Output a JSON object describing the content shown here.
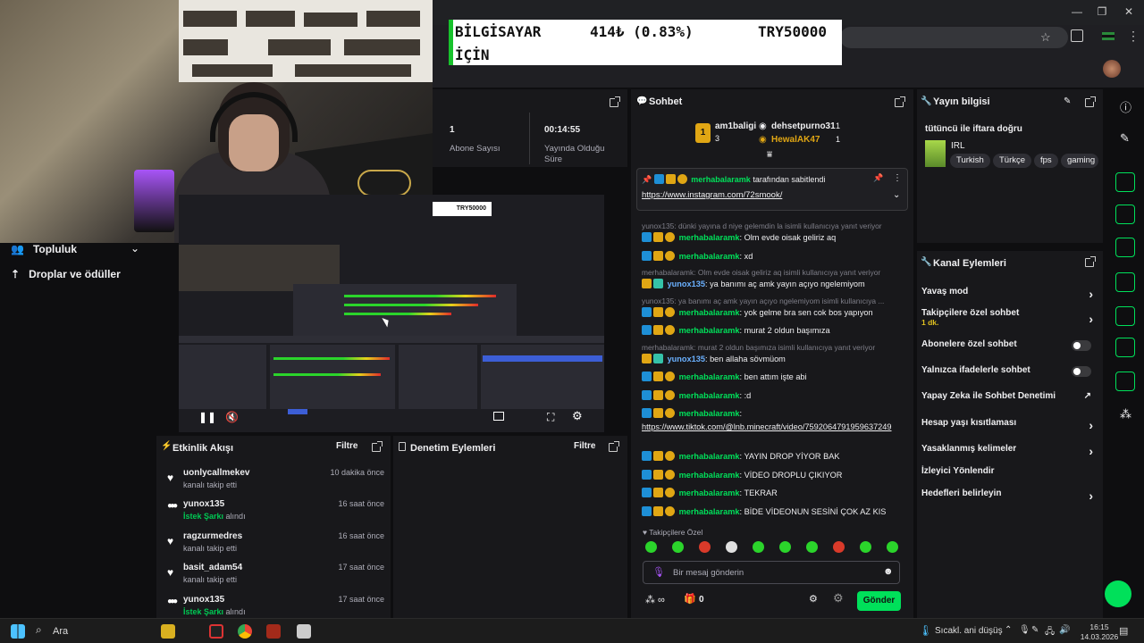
{
  "stock_banner": {
    "symbol_line1": "BİLGİSAYAR",
    "symbol_line2": "İÇİN",
    "change": "414₺ (0.83%)",
    "goal": "TRY50000"
  },
  "sidebar": {
    "items": [
      {
        "label": "Topluluk",
        "icon": "people-icon"
      },
      {
        "label": "Droplar ve ödüller",
        "icon": "gift-icon"
      }
    ]
  },
  "stats": {
    "subscribers_value": "1",
    "subscribers_label": "Abone Sayısı",
    "uptime_value": "00:14:55",
    "uptime_label": "Yayında Olduğu Süre"
  },
  "preview": {
    "overlay_goal": "TRY50000"
  },
  "activity": {
    "title": "Etkinlik Akışı",
    "filter": "Filtre",
    "items": [
      {
        "user": "uonlycallmekev",
        "action": "kanalı takip etti",
        "highlight": "",
        "time": "10 dakika önce",
        "icon": "heart"
      },
      {
        "user": "yunox135",
        "action": "alındı",
        "highlight": "İstek Şarkı",
        "time": "16 saat önce",
        "icon": "points"
      },
      {
        "user": "ragzurmedres",
        "action": "kanalı takip etti",
        "highlight": "",
        "time": "16 saat önce",
        "icon": "heart"
      },
      {
        "user": "basit_adam54",
        "action": "kanalı takip etti",
        "highlight": "",
        "time": "17 saat önce",
        "icon": "heart"
      },
      {
        "user": "yunox135",
        "action": "alındı",
        "highlight": "İstek Şarkı",
        "time": "17 saat önce",
        "icon": "points"
      }
    ]
  },
  "moderation": {
    "title": "Denetim Eylemleri",
    "filter": "Filtre"
  },
  "chat": {
    "title": "Sohbet",
    "leaderboard": {
      "first_name": "am1baligi",
      "first_count": "3",
      "second_name": "dehsetpurno31",
      "second_count": "1",
      "third_name": "HewalAK47",
      "third_count": "1"
    },
    "pinned_by": "merhabalaramk",
    "pinned_label": "tarafından sabitlendi",
    "pinned_link": "https://www.instagram.com/72smook/",
    "messages": [
      {
        "reply": "yunox135: dünki yayına d niye gelemdin la isimli kullanıcıya yanıt veriyor",
        "user": "merhabalaramk",
        "text": "Olm evde oisak geliriz aq",
        "style": "green"
      },
      {
        "reply": "",
        "user": "merhabalaramk",
        "text": "xd",
        "style": "green"
      },
      {
        "reply": "merhabalaramk: Olm evde oisak geliriz aq isimli kullanıcıya yanıt veriyor",
        "user": "yunox135",
        "text": "ya banımı aç amk yayın açıyo ngelemiyom",
        "style": "blue"
      },
      {
        "reply": "yunox135: ya banımı aç amk yayın açıyo ngelemiyom isimli kullanıcıya ...",
        "user": "merhabalaramk",
        "text": "yok gelme bra sen cok bos yapıyon",
        "style": "green"
      },
      {
        "reply": "",
        "user": "merhabalaramk",
        "text": "murat 2 oldun başımıza",
        "style": "green"
      },
      {
        "reply": "merhabalaramk: murat 2 oldun başımıza isimli kullanıcıya yanıt veriyor",
        "user": "yunox135",
        "text": "ben allaha sövmüom",
        "style": "blue"
      },
      {
        "reply": "",
        "user": "merhabalaramk",
        "text": "ben attım işte abi",
        "style": "green"
      },
      {
        "reply": "",
        "user": "merhabalaramk",
        "text": ":d",
        "style": "green"
      },
      {
        "reply": "",
        "user": "merhabalaramk",
        "text": "https://www.tiktok.com/@lnb.minecraft/video/7592064791959637249",
        "style": "green"
      },
      {
        "reply": "",
        "user": "merhabalaramk",
        "text": "YAYIN DROP YİYOR BAK",
        "style": "green"
      },
      {
        "reply": "",
        "user": "merhabalaramk",
        "text": "VİDEO DROPLU ÇIKIYOR",
        "style": "green"
      },
      {
        "reply": "",
        "user": "merhabalaramk",
        "text": "TEKRAR",
        "style": "green"
      },
      {
        "reply": "",
        "user": "merhabalaramk",
        "text": "BİDE VİDEONUN SESİNİ ÇOK AZ KIS",
        "style": "green"
      }
    ],
    "followers_only_label": "Takipçilere Özel",
    "input_placeholder": "Bir mesaj gönderin",
    "points": "0",
    "send_label": "Gönder"
  },
  "stream_info": {
    "title": "Yayın bilgisi",
    "stream_title": "tütüncü ile iftara doğru",
    "category": "IRL",
    "tags": [
      "Turkish",
      "Türkçe",
      "fps",
      "gaming"
    ]
  },
  "channel_actions": {
    "title": "Kanal Eylemleri",
    "items": [
      {
        "label": "Yavaş mod",
        "sub": "",
        "control": "chevron"
      },
      {
        "label": "Takipçilere özel sohbet",
        "sub": "1 dk.",
        "control": "chevron"
      },
      {
        "label": "Abonelere özel sohbet",
        "sub": "",
        "control": "toggle"
      },
      {
        "label": "Yalnızca ifadelerle sohbet",
        "sub": "",
        "control": "toggle"
      },
      {
        "label": "Yapay Zeka ile Sohbet Denetimi",
        "sub": "",
        "control": "external"
      },
      {
        "label": "Hesap yaşı kısıtlaması",
        "sub": "",
        "control": "chevron"
      },
      {
        "label": "Yasaklanmış kelimeler",
        "sub": "",
        "control": "chevron"
      },
      {
        "label": "İzleyici Yönlendir",
        "sub": "",
        "control": "none"
      },
      {
        "label": "Hedefleri belirleyin",
        "sub": "",
        "control": "chevron"
      }
    ]
  },
  "taskbar": {
    "search_label": "Ara",
    "weather": "Sıcakl. ani düşüş",
    "time": "16:15",
    "date": "14.03.2026"
  },
  "colors": {
    "accent": "#00e05a",
    "panel": "#18181b",
    "background": "#0e0e10"
  }
}
